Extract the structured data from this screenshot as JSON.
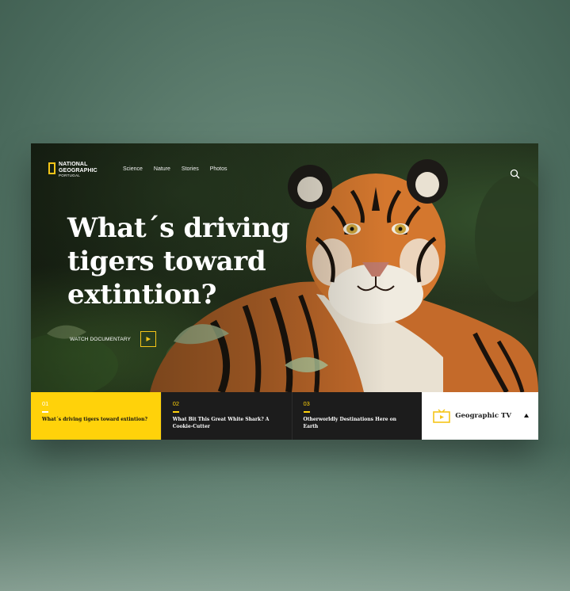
{
  "brand": {
    "line1": "NATIONAL",
    "line2": "GEOGRAPHIC",
    "line3": "PORTUGAL",
    "accent": "#f5c518"
  },
  "nav": {
    "items": [
      "Science",
      "Nature",
      "Stories",
      "Photos"
    ],
    "search_icon": "search-icon"
  },
  "hero": {
    "headline_l1": "What´s driving",
    "headline_l2": "tigers toward",
    "headline_l3": "extintion?",
    "watch_label": "WATCH DOCUMENTARY",
    "play_icon": "play-icon"
  },
  "stories": [
    {
      "num": "01",
      "title": "What´s driving tigers toward extintion?"
    },
    {
      "num": "02",
      "title": "What Bit This Great White Shark? A Cookie-Cutter"
    },
    {
      "num": "03",
      "title": "Otherworldly Destinations Here on Earth"
    }
  ],
  "tv": {
    "label": "Geographic TV",
    "icon": "tv-icon"
  },
  "colors": {
    "yellow": "#ffd20a",
    "dark": "#1c1c1c",
    "white": "#ffffff"
  }
}
